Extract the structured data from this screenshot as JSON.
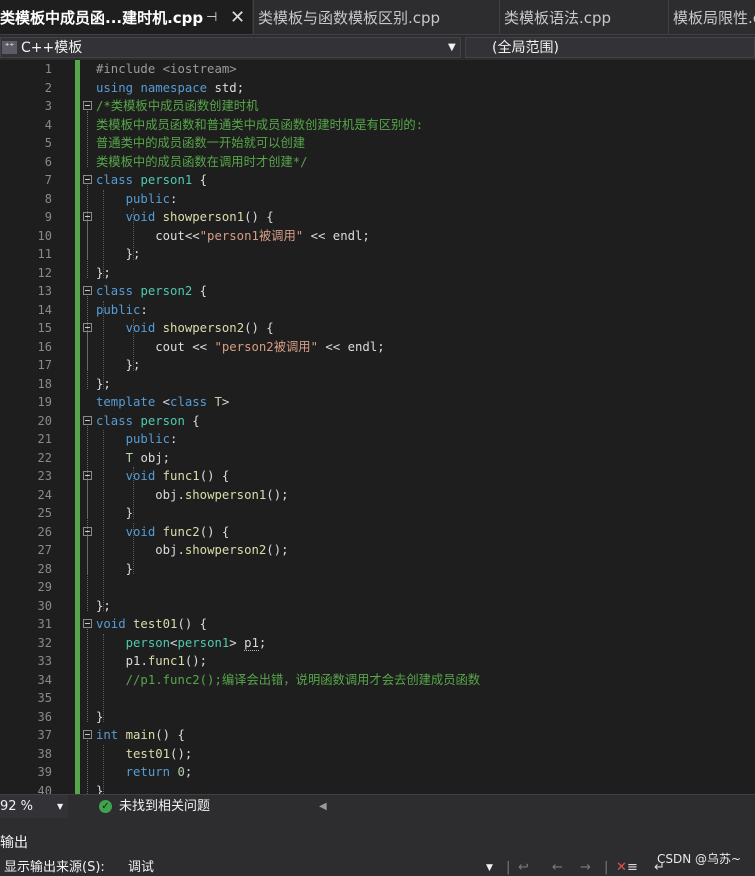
{
  "tabs": [
    {
      "label": "类模板中成员函...建时机.cpp",
      "active": true
    },
    {
      "label": "类模板与函数模板区别.cpp"
    },
    {
      "label": "类模板语法.cpp"
    },
    {
      "label": "模板局限性.cpp"
    }
  ],
  "tab_pin_icon": "pin-icon",
  "tab_close_glyph": "✕",
  "nav": {
    "project": "C++模板",
    "scope": "(全局范围)"
  },
  "editor": {
    "line_numbers": [
      "1",
      "2",
      "3",
      "4",
      "5",
      "6",
      "7",
      "8",
      "9",
      "10",
      "11",
      "12",
      "13",
      "14",
      "15",
      "16",
      "17",
      "18",
      "19",
      "20",
      "21",
      "22",
      "23",
      "24",
      "25",
      "26",
      "27",
      "28",
      "29",
      "30",
      "31",
      "32",
      "33",
      "34",
      "35",
      "36",
      "37",
      "38",
      "39",
      "40"
    ],
    "code_lines": [
      "#include <iostream>",
      "using namespace std;",
      "/*类模板中成员函数创建时机",
      "类模板中成员函数和普通类中成员函数创建时机是有区别的:",
      "普通类中的成员函数一开始就可以创建",
      "类模板中的成员函数在调用时才创建*/",
      "class person1 {",
      "    public:",
      "    void showperson1() {",
      "        cout<<\"person1被调用\" << endl;",
      "    };",
      "};",
      "class person2 {",
      "public:",
      "    void showperson2() {",
      "        cout << \"person2被调用\" << endl;",
      "    };",
      "};",
      "template <class T>",
      "class person {",
      "    public:",
      "    T obj;",
      "    void func1() {",
      "        obj.showperson1();",
      "    }",
      "    void func2() {",
      "        obj.showperson2();",
      "    }",
      "",
      "};",
      "void test01() {",
      "    person<person1> p1;",
      "    p1.func1();",
      "    //p1.func2();编译会出错，说明函数调用才会去创建成员函数",
      "",
      "}",
      "int main() {",
      "    test01();",
      "    return 0;",
      "}"
    ]
  },
  "status": {
    "zoom": "92 %",
    "issues": "未找到相关问题"
  },
  "output": {
    "title": "输出",
    "source_label": "显示输出来源(S):",
    "source_value": "调试"
  },
  "watermark": "CSDN @乌苏~",
  "colors": {
    "keyword": "#569cd6",
    "comment": "#57a64a",
    "string": "#d69d85",
    "type": "#4ec9b0",
    "function": "#dcdcaa",
    "change_bar": "#57a64a"
  }
}
